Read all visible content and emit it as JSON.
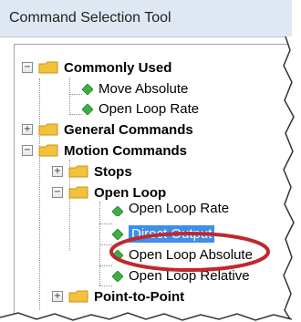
{
  "window": {
    "title": "Command Selection Tool"
  },
  "tree": {
    "items": [
      {
        "label": "Commonly Used",
        "type": "folder",
        "expander": "−",
        "bold": true
      },
      {
        "label": "Move Absolute",
        "type": "command"
      },
      {
        "label": "Open Loop Rate",
        "type": "command"
      },
      {
        "label": "General Commands",
        "type": "folder",
        "expander": "+",
        "bold": true
      },
      {
        "label": "Motion Commands",
        "type": "folder",
        "expander": "−",
        "bold": true
      },
      {
        "label": "Stops",
        "type": "folder",
        "expander": "+",
        "bold": true
      },
      {
        "label": "Open Loop",
        "type": "folder",
        "expander": "−",
        "bold": true
      },
      {
        "label": "Open Loop Rate",
        "type": "command"
      },
      {
        "label": "Direct Output",
        "type": "command",
        "selected": true
      },
      {
        "label": "Open Loop Absolute",
        "type": "command"
      },
      {
        "label": "Open Loop Relative",
        "type": "command"
      },
      {
        "label": "Point-to-Point",
        "type": "folder",
        "expander": "+",
        "bold": true
      }
    ]
  },
  "colors": {
    "selection": "#3f8ee8",
    "highlight_ellipse": "#c0282d",
    "folder": "#f2c23c",
    "command_icon": "#3cb043"
  },
  "icons": {
    "folder": "folder-icon",
    "command": "diamond-icon"
  }
}
